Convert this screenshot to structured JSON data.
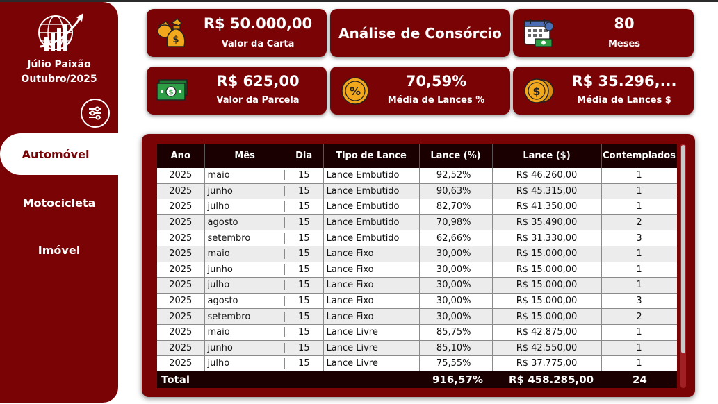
{
  "user": {
    "name": "Júlio Paixão",
    "period": "Outubro/2025"
  },
  "nav": {
    "items": [
      {
        "label": "Automóvel",
        "active": true
      },
      {
        "label": "Motocicleta",
        "active": false
      },
      {
        "label": "Imóvel",
        "active": false
      }
    ]
  },
  "cards": {
    "carta": {
      "value": "R$ 50.000,00",
      "label": "Valor da Carta",
      "icon": "money-bag-icon"
    },
    "title": {
      "text": "Análise de Consórcio"
    },
    "meses": {
      "value": "80",
      "label": "Meses",
      "icon": "calendar-money-icon"
    },
    "parcela": {
      "value": "R$ 625,00",
      "label": "Valor da Parcela",
      "icon": "banknote-icon"
    },
    "media_pct": {
      "value": "70,59%",
      "label": "Média de Lances %",
      "icon": "percent-coin-icon"
    },
    "media_valor": {
      "value": "R$ 35.296,...",
      "label": "Média de Lances $",
      "icon": "dollar-coin-icon"
    }
  },
  "table": {
    "headers": [
      "Ano",
      "Mês",
      "Dia",
      "Tipo de Lance",
      "Lance (%)",
      "Lance ($)",
      "Contemplados"
    ],
    "rows": [
      [
        "2025",
        "maio",
        "15",
        "Lance Embutido",
        "92,52%",
        "R$ 46.260,00",
        "1"
      ],
      [
        "2025",
        "junho",
        "15",
        "Lance Embutido",
        "90,63%",
        "R$ 45.315,00",
        "1"
      ],
      [
        "2025",
        "julho",
        "15",
        "Lance Embutido",
        "82,70%",
        "R$ 41.350,00",
        "1"
      ],
      [
        "2025",
        "agosto",
        "15",
        "Lance Embutido",
        "70,98%",
        "R$ 35.490,00",
        "2"
      ],
      [
        "2025",
        "setembro",
        "15",
        "Lance Embutido",
        "62,66%",
        "R$ 31.330,00",
        "3"
      ],
      [
        "2025",
        "maio",
        "15",
        "Lance Fixo",
        "30,00%",
        "R$ 15.000,00",
        "1"
      ],
      [
        "2025",
        "junho",
        "15",
        "Lance Fixo",
        "30,00%",
        "R$ 15.000,00",
        "1"
      ],
      [
        "2025",
        "julho",
        "15",
        "Lance Fixo",
        "30,00%",
        "R$ 15.000,00",
        "1"
      ],
      [
        "2025",
        "agosto",
        "15",
        "Lance Fixo",
        "30,00%",
        "R$ 15.000,00",
        "3"
      ],
      [
        "2025",
        "setembro",
        "15",
        "Lance Fixo",
        "30,00%",
        "R$ 15.000,00",
        "2"
      ],
      [
        "2025",
        "maio",
        "15",
        "Lance Livre",
        "85,75%",
        "R$ 42.875,00",
        "1"
      ],
      [
        "2025",
        "junho",
        "15",
        "Lance Livre",
        "85,10%",
        "R$ 42.550,00",
        "1"
      ],
      [
        "2025",
        "julho",
        "15",
        "Lance Livre",
        "75,55%",
        "R$ 37.775,00",
        "1"
      ]
    ],
    "total": {
      "label": "Total",
      "pct": "916,57%",
      "value": "R$ 458.285,00",
      "contemplados": "24"
    }
  },
  "colors": {
    "brand": "#7a0306",
    "header": "#1a0000",
    "row_alt": "#ececec",
    "icon_gold": "#f2a81d",
    "icon_green": "#2e9e46"
  }
}
